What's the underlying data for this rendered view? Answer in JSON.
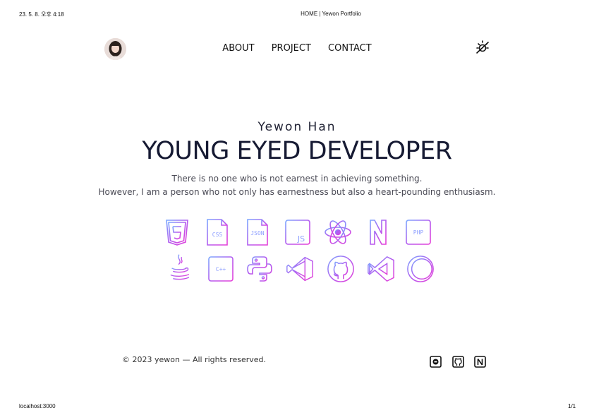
{
  "print": {
    "datetime": "23. 5. 8. 오후 4:18",
    "page_title": "HOME | Yewon Portfolio",
    "url": "localhost:3000",
    "page_count": "1/1"
  },
  "nav": {
    "items": [
      "ABOUT",
      "PROJECT",
      "CONTACT"
    ]
  },
  "hero": {
    "name": "Yewon Han",
    "title": "YOUNG EYED DEVELOPER",
    "line1": "There is no one who is not earnest in achieving something.",
    "line2": "However, I am a person who not only has earnestness but also a heart-pounding enthusiasm."
  },
  "skills": {
    "row1": [
      "html5-icon",
      "css-icon",
      "json-icon",
      "js-icon",
      "react-icon",
      "nextjs-icon",
      "php-icon"
    ],
    "row2": [
      "java-icon",
      "cpp-icon",
      "python-icon",
      "vscode-icon",
      "github-icon",
      "visual-studio-icon",
      "eclipse-icon"
    ],
    "labels": {
      "css": "CSS",
      "json": "JSON",
      "js": "JS",
      "php": "PHP",
      "cpp": "C++"
    },
    "gradient": [
      "#7aa7ff",
      "#b25cf0",
      "#e63fd8"
    ]
  },
  "footer": {
    "copyright": "© 2023 yewon — All rights reserved.",
    "social": [
      "blog-icon",
      "github-icon",
      "notion-icon"
    ]
  }
}
